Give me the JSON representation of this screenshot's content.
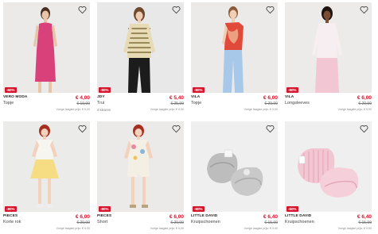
{
  "products": [
    {
      "brand": "VERO MODA",
      "name": "Topje",
      "colors": "",
      "discount": "-60%",
      "price": "€ 4,00",
      "old_price": "€ 19,99",
      "ref_price": "Vorige laagste prijs: € 9,00",
      "photo_bg": "#ebeae8",
      "icon": "heart-icon"
    },
    {
      "brand": "JDY",
      "name": "Trui",
      "colors": "4 kleuren",
      "discount": "-80%",
      "price": "€ 5,40",
      "old_price": "€ 25,99",
      "ref_price": "Vorige laagste prijs: € 9,00",
      "photo_bg": "#e8e8e9",
      "icon": "heart-icon"
    },
    {
      "brand": "VILA",
      "name": "Topje",
      "colors": "",
      "discount": "-80%",
      "price": "€ 6,00",
      "old_price": "€ 29,99",
      "ref_price": "Vorige laagste prijs: € 9,00",
      "photo_bg": "#ebeae9",
      "icon": "heart-icon"
    },
    {
      "brand": "VILA",
      "name": "Longsleeves",
      "colors": "",
      "discount": "-80%",
      "price": "€ 6,00",
      "old_price": "€ 29,99",
      "ref_price": "Vorige laagste prijs: € 9,00",
      "photo_bg": "#ecebe9",
      "icon": "heart-icon"
    },
    {
      "brand": "PIECES",
      "name": "Korte rok",
      "colors": "",
      "discount": "-80%",
      "price": "€ 6,00",
      "old_price": "€ 29,99",
      "ref_price": "Vorige laagste prijs: € 9,00",
      "photo_bg": "#ebebea",
      "icon": "heart-icon"
    },
    {
      "brand": "PIECES",
      "name": "Short",
      "colors": "",
      "discount": "-80%",
      "price": "€ 6,00",
      "old_price": "€ 29,99",
      "ref_price": "Vorige laagste prijs: € 9,00",
      "photo_bg": "#ebeae9",
      "icon": "heart-icon"
    },
    {
      "brand": "LITTLE DAVID",
      "name": "Kruipschoenen",
      "colors": "",
      "discount": "-60%",
      "price": "€ 6,40",
      "old_price": "€ 15,99",
      "ref_price": "Vorige laagste prijs: € 9,00",
      "photo_bg": "#efefef",
      "icon": "heart-icon"
    },
    {
      "brand": "LITTLE DAVID",
      "name": "Kruipschoenen",
      "colors": "",
      "discount": "-60%",
      "price": "€ 6,40",
      "old_price": "€ 15,99",
      "ref_price": "Vorige laagste prijs: € 9,00",
      "photo_bg": "#f0efef",
      "icon": "heart-icon"
    }
  ],
  "colors": {
    "sale_red": "#d6162d",
    "text": "#222222",
    "muted": "#777777"
  }
}
